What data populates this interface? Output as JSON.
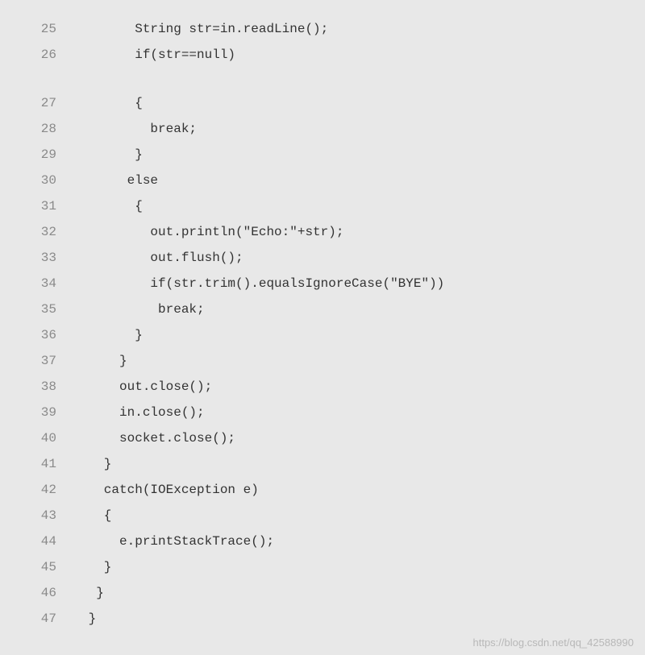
{
  "code": {
    "lines": [
      {
        "num": "25",
        "indent": "       ",
        "text": "String str=in.readLine();"
      },
      {
        "num": "26",
        "indent": "       ",
        "text": "if(str==null)"
      },
      {
        "blank": true
      },
      {
        "num": "27",
        "indent": "       ",
        "text": "{"
      },
      {
        "num": "28",
        "indent": "         ",
        "text": "break;"
      },
      {
        "num": "29",
        "indent": "       ",
        "text": "}"
      },
      {
        "num": "30",
        "indent": "      ",
        "text": "else"
      },
      {
        "num": "31",
        "indent": "       ",
        "text": "{"
      },
      {
        "num": "32",
        "indent": "         ",
        "text": "out.println(\"Echo:\"+str);"
      },
      {
        "num": "33",
        "indent": "         ",
        "text": "out.flush();"
      },
      {
        "num": "34",
        "indent": "         ",
        "text": "if(str.trim().equalsIgnoreCase(\"BYE\"))"
      },
      {
        "num": "35",
        "indent": "          ",
        "text": "break;"
      },
      {
        "num": "36",
        "indent": "       ",
        "text": "}"
      },
      {
        "num": "37",
        "indent": "     ",
        "text": "}"
      },
      {
        "num": "38",
        "indent": "     ",
        "text": "out.close();"
      },
      {
        "num": "39",
        "indent": "     ",
        "text": "in.close();"
      },
      {
        "num": "40",
        "indent": "     ",
        "text": "socket.close();"
      },
      {
        "num": "41",
        "indent": "   ",
        "text": "}"
      },
      {
        "num": "42",
        "indent": "   ",
        "text": "catch(IOException e)"
      },
      {
        "num": "43",
        "indent": "   ",
        "text": "{"
      },
      {
        "num": "44",
        "indent": "     ",
        "text": "e.printStackTrace();"
      },
      {
        "num": "45",
        "indent": "   ",
        "text": "}"
      },
      {
        "num": "46",
        "indent": "  ",
        "text": "}"
      },
      {
        "num": "47",
        "indent": " ",
        "text": "}"
      }
    ]
  },
  "watermark": "https://blog.csdn.net/qq_42588990"
}
